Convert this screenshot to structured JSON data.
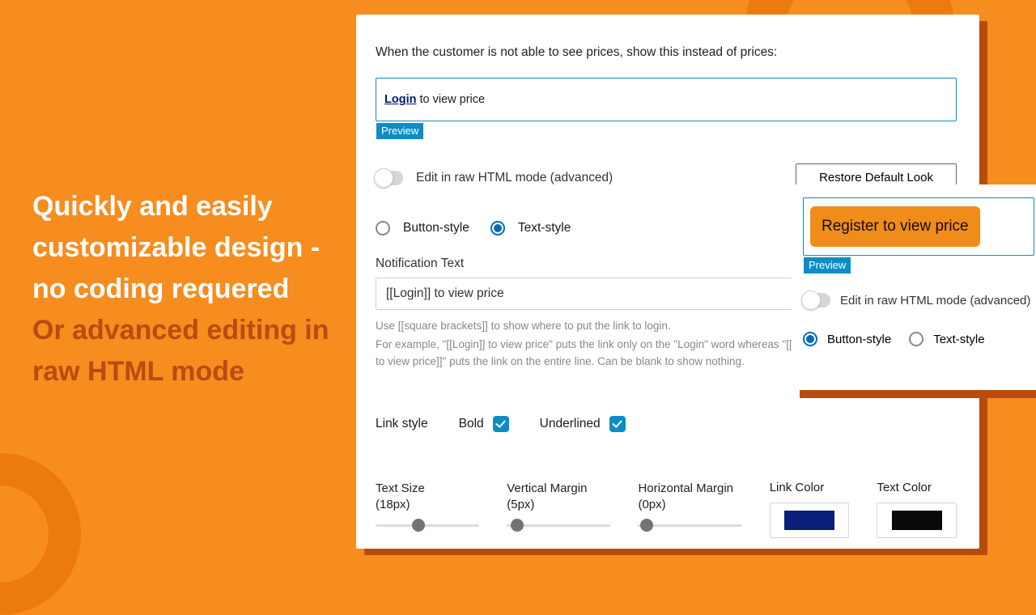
{
  "colors": {
    "accent_blue": "#0d8dc5",
    "link_navy": "#001a70",
    "brand_orange": "#f78c1f",
    "swatch_link": "#0b1e7a",
    "swatch_text": "#0a0a0a"
  },
  "headline": {
    "line1": "Quickly and easily customizable design - no coding requered",
    "line2": "Or advanced editing in raw HTML mode"
  },
  "panel": {
    "intro": "When the customer is not able to see prices, show this instead of prices:",
    "preview_link_text": "Login",
    "preview_after_link": " to view price",
    "preview_badge": "Preview",
    "raw_html_toggle": "Edit in raw HTML mode (advanced)",
    "restore_button": "Restore Default Look",
    "style_radio": {
      "button": "Button-style",
      "text": "Text-style",
      "selected": "text"
    },
    "notification_label": "Notification Text",
    "notification_value": "[[Login]] to view price",
    "helper1": "Use [[square brackets]] to show where to put the link to login.",
    "helper2": "For example, \"[[Login]] to view price\" puts the link only on the \"Login\" word whereas \"[[Login to view price]]\" puts the link on the entire line. Can be blank to show nothing.",
    "link_style_label": "Link style",
    "bold_label": "Bold",
    "underlined_label": "Underlined",
    "sliders": {
      "text_size": {
        "label": "Text Size",
        "value_text": "(18px)",
        "pos": 0.35
      },
      "v_margin": {
        "label": "Vertical Margin",
        "value_text": "(5px)",
        "pos": 0.08
      },
      "h_margin": {
        "label": "Horizontal Margin",
        "value_text": "(0px)",
        "pos": 0.05
      }
    },
    "link_color_label": "Link Color",
    "text_color_label": "Text Color"
  },
  "popover": {
    "register_button": "Register to view price",
    "preview_badge": "Preview",
    "raw_html_toggle": "Edit in raw HTML mode (advanced)",
    "style_radio": {
      "button": "Button-style",
      "text": "Text-style",
      "selected": "button"
    }
  }
}
